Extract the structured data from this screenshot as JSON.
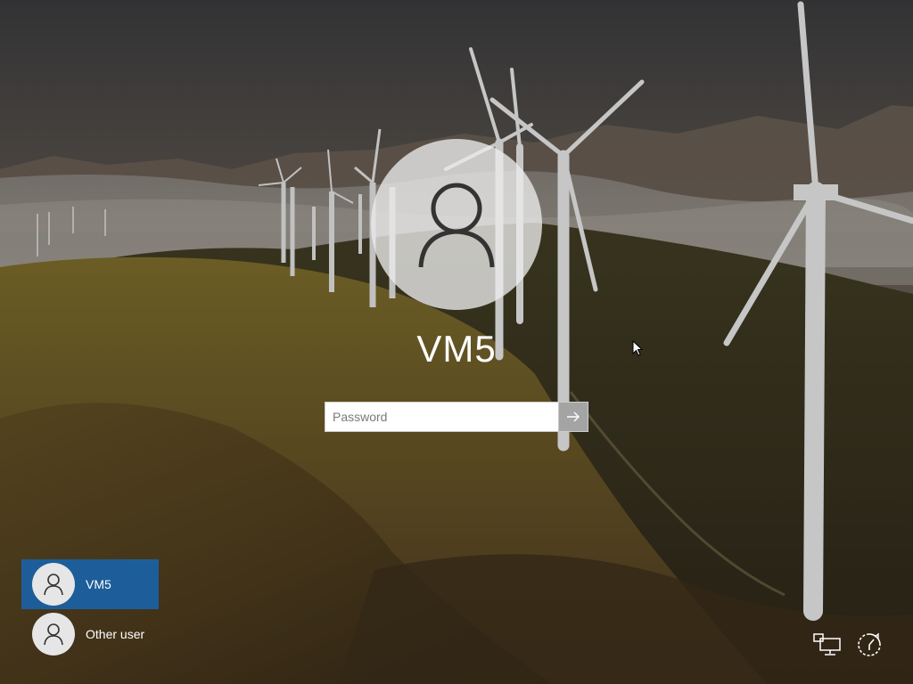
{
  "login": {
    "username": "VM5",
    "password_placeholder": "Password",
    "password_value": ""
  },
  "users": [
    {
      "name": "VM5",
      "selected": true
    },
    {
      "name": "Other user",
      "selected": false
    }
  ],
  "icons": {
    "network": "network-icon",
    "ease_of_access": "ease-of-access-icon",
    "submit": "arrow-right-icon",
    "avatar": "user-icon",
    "pointer": "mouse-pointer-icon"
  },
  "colors": {
    "selected_user_bg": "#1d5e9a",
    "text": "#ffffff"
  }
}
